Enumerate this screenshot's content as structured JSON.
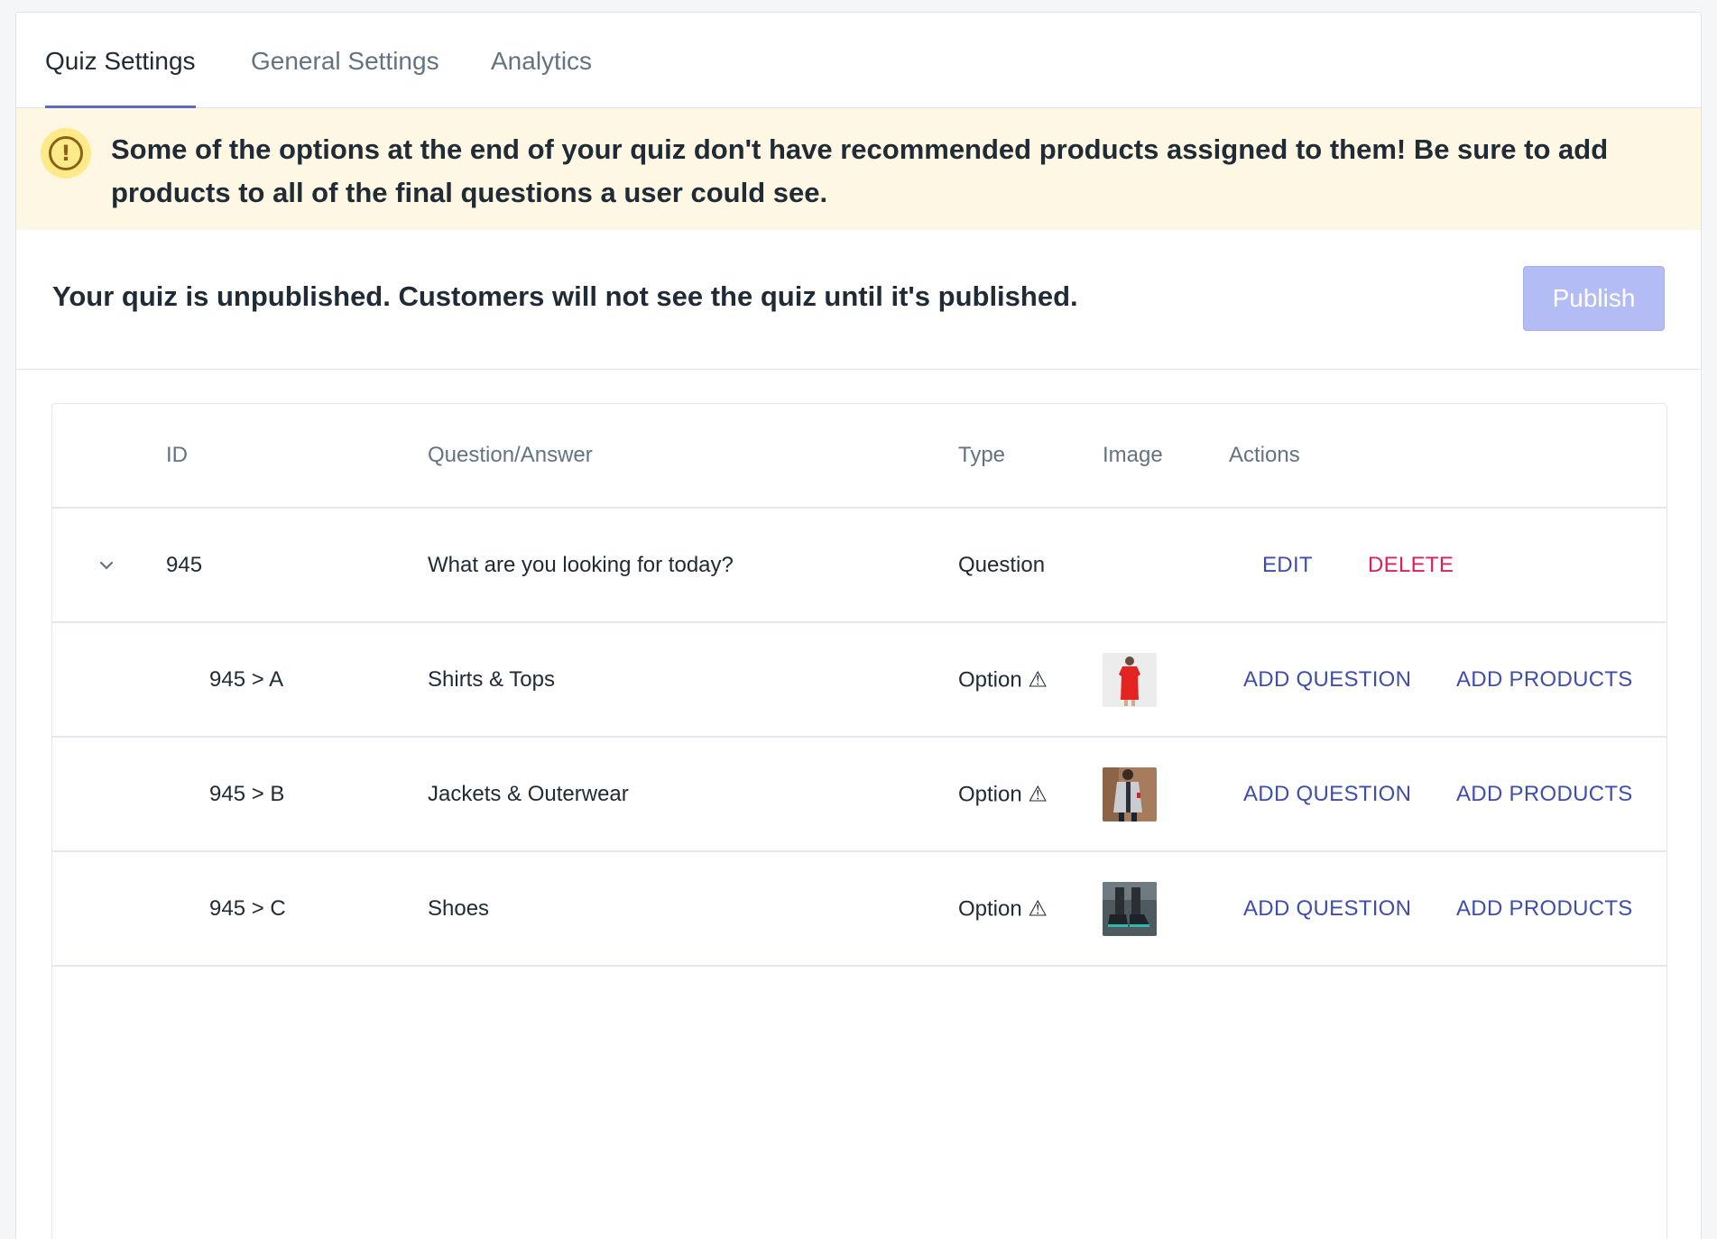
{
  "tabs": [
    {
      "label": "Quiz Settings",
      "active": true
    },
    {
      "label": "General Settings",
      "active": false
    },
    {
      "label": "Analytics",
      "active": false
    }
  ],
  "banner": {
    "icon": "alert-circle-icon",
    "text": "Some of the options at the end of your quiz don't have recommended products assigned to them! Be sure to add products to all of the final questions a user could see.",
    "color": "#fdf7e3"
  },
  "publish": {
    "status_text": "Your quiz is unpublished. Customers will not see the quiz until it's published.",
    "button_label": "Publish"
  },
  "table": {
    "columns": [
      "ID",
      "Question/Answer",
      "Type",
      "Image",
      "Actions"
    ],
    "rows": [
      {
        "id": "945",
        "text": "What are you looking for today?",
        "type": "Question",
        "actions": [
          "EDIT",
          "DELETE"
        ]
      },
      {
        "id": "945 > A",
        "text": "Shirts & Tops",
        "type": "Option ⚠",
        "image": "red-dress-thumbnail",
        "actions": [
          "ADD QUESTION",
          "ADD PRODUCTS"
        ]
      },
      {
        "id": "945 > B",
        "text": "Jackets & Outerwear",
        "type": "Option ⚠",
        "image": "jacket-thumbnail",
        "actions": [
          "ADD QUESTION",
          "ADD PRODUCTS"
        ]
      },
      {
        "id": "945 > C",
        "text": "Shoes",
        "type": "Option ⚠",
        "image": "shoes-thumbnail",
        "actions": [
          "ADD QUESTION",
          "ADD PRODUCTS"
        ]
      }
    ]
  },
  "colors": {
    "accent": "#5c6ac4",
    "link": "#3f4eae",
    "danger": "#de1f5a"
  }
}
